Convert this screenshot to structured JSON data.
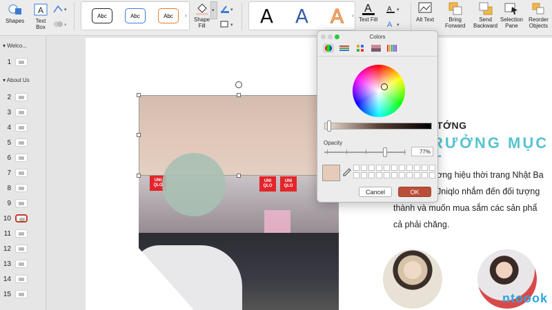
{
  "ribbon": {
    "shapes": "Shapes",
    "text_box_1": "Text",
    "text_box_2": "Box",
    "style_abc": [
      "Abc",
      "Abc",
      "Abc"
    ],
    "shape_fill_1": "Shape",
    "shape_fill_2": "Fill",
    "wordart": [
      "A",
      "A",
      "A"
    ],
    "text_fill": "Text Fill",
    "alt_text": "Alt Text",
    "bring_forward_1": "Bring",
    "bring_forward_2": "Forward",
    "send_backward_1": "Send",
    "send_backward_2": "Backward",
    "selection_pane_1": "Selection",
    "selection_pane_2": "Pane",
    "reorder_1": "Reorder",
    "reorder_2": "Objects"
  },
  "thumbs": {
    "section_welcome": "Welco...",
    "section_about": "About Us",
    "numbers": [
      "1",
      "2",
      "3",
      "4",
      "5",
      "6",
      "7",
      "8",
      "9",
      "10",
      "11",
      "12",
      "13",
      "14",
      "15"
    ],
    "active": "10"
  },
  "slide": {
    "heading": "TỚNG",
    "subheading": "RƯỞNG MỤC T",
    "body": [
      "ơng hiệu thời trang Nhật Ba",
      "Jniqlo nhắm đến đối tượng",
      "thành và muốn mua sắm các sản phẩ",
      "cả phải chăng."
    ],
    "logo_text": "UNI QLO",
    "watermark": "ntoook"
  },
  "colors_panel": {
    "title": "Colors",
    "opacity_label": "Opacity",
    "opacity_value": "77%",
    "opacity": 0.77,
    "cancel": "Cancel",
    "ok": "OK",
    "selected_color": "#e7cbb9"
  }
}
